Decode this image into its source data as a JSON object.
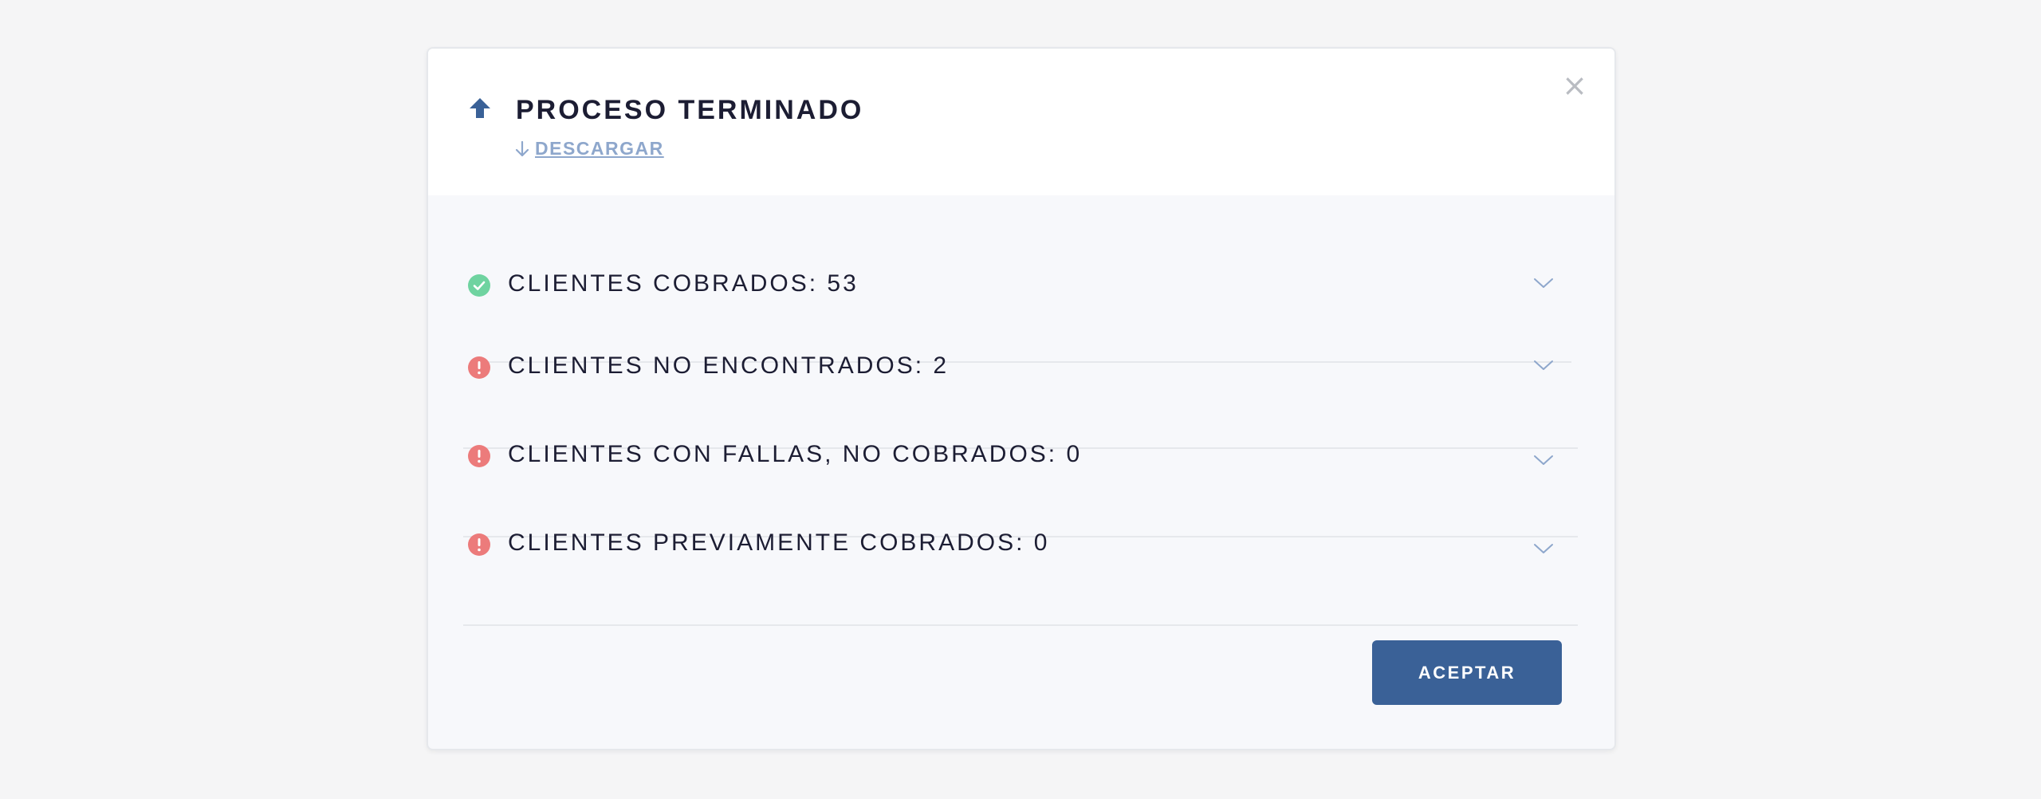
{
  "modal": {
    "title": "PROCESO TERMINADO",
    "download_label": "DESCARGAR",
    "close_symbol": "×",
    "accept_label": "ACEPTAR"
  },
  "rows": [
    {
      "label": "CLIENTES COBRADOS: 53",
      "status": "success",
      "status_icon": "check-circle-icon"
    },
    {
      "label": "CLIENTES NO ENCONTRADOS: 2",
      "status": "error",
      "status_icon": "alert-circle-icon"
    },
    {
      "label": "CLIENTES CON FALLAS, NO COBRADOS: 0",
      "status": "error",
      "status_icon": "alert-circle-icon"
    },
    {
      "label": "CLIENTES PREVIAMENTE COBRADOS: 0",
      "status": "error",
      "status_icon": "alert-circle-icon"
    }
  ],
  "colors": {
    "primary": "#3a6197",
    "success": "#6fd3a0",
    "error": "#ec7b7b",
    "link": "#8ea7cc",
    "text": "#1c1d33"
  }
}
